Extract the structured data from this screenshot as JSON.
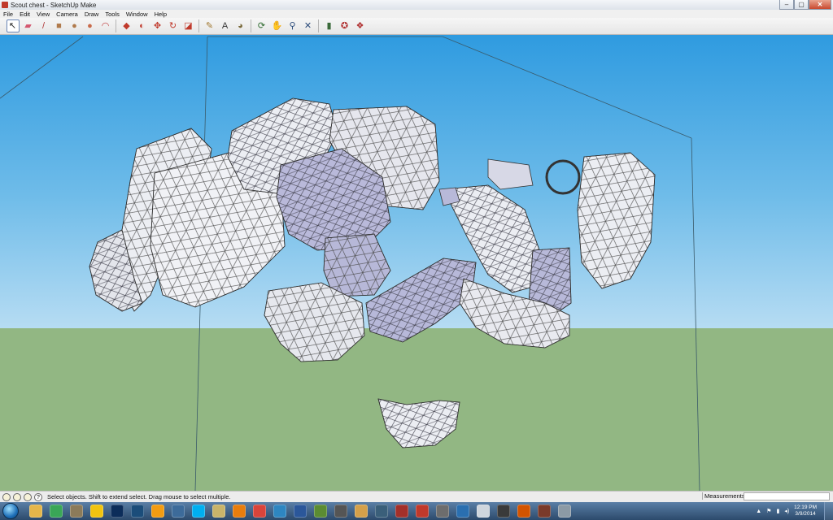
{
  "window": {
    "title": "Scout chest - SketchUp Make",
    "controls": [
      "–",
      "▢",
      "✕"
    ]
  },
  "menu": [
    "File",
    "Edit",
    "View",
    "Camera",
    "Draw",
    "Tools",
    "Window",
    "Help"
  ],
  "toolbar": {
    "tools": [
      {
        "name": "select-tool",
        "glyph": "↖",
        "color": "#222222",
        "active": true
      },
      {
        "name": "eraser-tool",
        "glyph": "▰",
        "color": "#d4576f"
      },
      {
        "name": "pencil-tool",
        "glyph": "/",
        "color": "#b23b3b"
      },
      {
        "name": "rectangle-tool",
        "glyph": "■",
        "color": "#b07a4b"
      },
      {
        "name": "circle-tool",
        "glyph": "●",
        "color": "#b07a4b"
      },
      {
        "name": "polygon-tool",
        "glyph": "●",
        "color": "#c96b4b"
      },
      {
        "name": "arc-tool",
        "glyph": "◠",
        "color": "#c04040"
      },
      {
        "name": "push-pull-tool",
        "glyph": "◆",
        "color": "#c0392b"
      },
      {
        "name": "follow-me-tool",
        "glyph": "◐",
        "color": "#c0392b"
      },
      {
        "name": "move-tool",
        "glyph": "✥",
        "color": "#c0392b"
      },
      {
        "name": "rotate-tool",
        "glyph": "↻",
        "color": "#c0392b"
      },
      {
        "name": "offset-tool",
        "glyph": "◪",
        "color": "#c0392b"
      },
      {
        "name": "tape-measure-tool",
        "glyph": "✎",
        "color": "#a0762b"
      },
      {
        "name": "text-tool",
        "glyph": "A",
        "color": "#333333"
      },
      {
        "name": "paint-bucket-tool",
        "glyph": "◕",
        "color": "#7a6a3a"
      },
      {
        "name": "orbit-tool",
        "glyph": "⟳",
        "color": "#2d6a2d"
      },
      {
        "name": "pan-tool",
        "glyph": "✋",
        "color": "#3a3a3a"
      },
      {
        "name": "zoom-tool",
        "glyph": "⚲",
        "color": "#2a4a7a"
      },
      {
        "name": "zoom-extents-tool",
        "glyph": "✕",
        "color": "#2a4a7a"
      },
      {
        "name": "warehouse-tool",
        "glyph": "▮",
        "color": "#3a6a3a"
      },
      {
        "name": "components-tool",
        "glyph": "✪",
        "color": "#b03030"
      },
      {
        "name": "extension-tool",
        "glyph": "❖",
        "color": "#b03030"
      }
    ]
  },
  "status": {
    "hint": "Select objects. Shift to extend select. Drag mouse to select multiple.",
    "measurements_label": "Measurements",
    "measurements_value": ""
  },
  "taskbar": {
    "apps": [
      {
        "name": "explorer-icon",
        "color": "#e5b64a"
      },
      {
        "name": "chrome-icon",
        "color": "#3aa757"
      },
      {
        "name": "media-icon",
        "color": "#8b7b5a"
      },
      {
        "name": "norton-icon",
        "color": "#f1c40f"
      },
      {
        "name": "photoshop-icon",
        "color": "#0c2d5a"
      },
      {
        "name": "steam-icon",
        "color": "#1b4d7a"
      },
      {
        "name": "vlc-icon",
        "color": "#f39c12"
      },
      {
        "name": "game-icon",
        "color": "#3d6b9a"
      },
      {
        "name": "skype-icon",
        "color": "#00aff0"
      },
      {
        "name": "game-99-icon",
        "color": "#c9b46a"
      },
      {
        "name": "blender-icon",
        "color": "#e87d0d"
      },
      {
        "name": "sketchup-icon",
        "color": "#d9443b"
      },
      {
        "name": "tool-icon",
        "color": "#2e86c1"
      },
      {
        "name": "word-icon",
        "color": "#2b579a"
      },
      {
        "name": "minecraft-icon",
        "color": "#5b8c32"
      },
      {
        "name": "skyrim-icon",
        "color": "#555555"
      },
      {
        "name": "map-icon",
        "color": "#d4a04a"
      },
      {
        "name": "nfs-icon",
        "color": "#3a5f7a"
      },
      {
        "name": "fcy-icon",
        "color": "#a3302a"
      },
      {
        "name": "game-red-icon",
        "color": "#c0392b"
      },
      {
        "name": "game-tall-icon",
        "color": "#6d6d6d"
      },
      {
        "name": "game-blue-icon",
        "color": "#2a6fb0"
      },
      {
        "name": "game-white-icon",
        "color": "#cfd6dd"
      },
      {
        "name": "game-dark-icon",
        "color": "#3a3a3a"
      },
      {
        "name": "game-orange-icon",
        "color": "#d35400"
      },
      {
        "name": "game-round-icon",
        "color": "#7a3a2a"
      },
      {
        "name": "game-grey-icon",
        "color": "#8c9aa5"
      }
    ],
    "tray": [
      "▲",
      "⚑",
      "▮",
      "◂)"
    ],
    "time": "12:19 PM",
    "date": "3/9/2014"
  }
}
